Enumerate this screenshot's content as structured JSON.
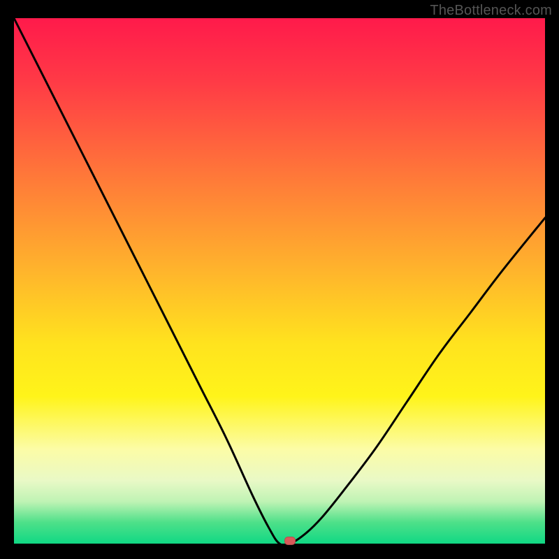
{
  "watermark": "TheBottleneck.com",
  "chart_data": {
    "type": "line",
    "title": "",
    "xlabel": "",
    "ylabel": "",
    "xlim": [
      0,
      100
    ],
    "ylim": [
      0,
      100
    ],
    "x": [
      0,
      5,
      10,
      15,
      20,
      25,
      30,
      35,
      40,
      45,
      48,
      50,
      52,
      55,
      58,
      62,
      68,
      74,
      80,
      86,
      92,
      100
    ],
    "values": [
      100,
      90,
      80,
      70,
      60,
      50,
      40,
      30,
      20,
      9,
      3,
      0,
      0,
      2,
      5,
      10,
      18,
      27,
      36,
      44,
      52,
      62
    ],
    "marker": {
      "x": 52,
      "y": 0
    },
    "colors": {
      "curve": "#000000",
      "marker": "#d85a5a",
      "gradient_top": "#ff1a4b",
      "gradient_bottom": "#10d884"
    }
  }
}
